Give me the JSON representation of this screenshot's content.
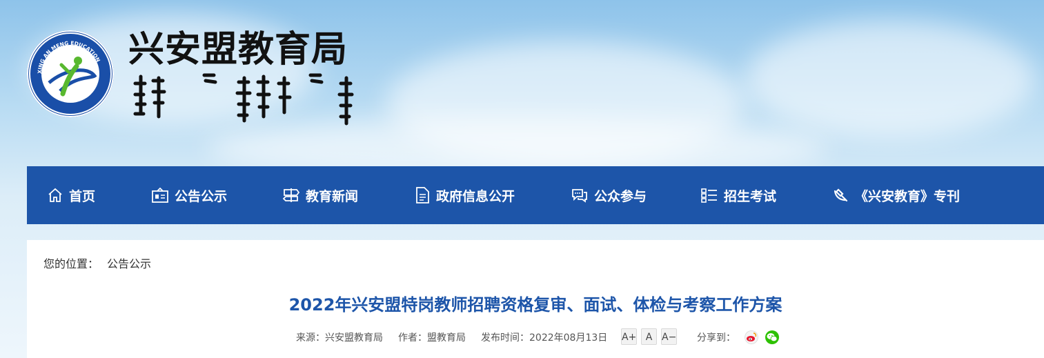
{
  "site": {
    "title": "兴安盟教育局",
    "emblem_text": "XING AN MENG EDUCATION"
  },
  "nav": {
    "items": [
      {
        "label": "首页",
        "icon": "home-icon"
      },
      {
        "label": "公告公示",
        "icon": "notice-board-icon"
      },
      {
        "label": "教育新闻",
        "icon": "signpost-icon"
      },
      {
        "label": "政府信息公开",
        "icon": "document-icon"
      },
      {
        "label": "公众参与",
        "icon": "chat-bubbles-icon"
      },
      {
        "label": "招生考试",
        "icon": "list-icon"
      },
      {
        "label": "《兴安教育》专刊",
        "icon": "party-emblem-icon"
      }
    ]
  },
  "breadcrumb": {
    "prefix": "您的位置：",
    "current": "公告公示"
  },
  "article": {
    "title": "2022年兴安盟特岗教师招聘资格复审、面试、体检与考察工作方案",
    "source": "来源：兴安盟教育局",
    "author": "作者：盟教育局",
    "date": "发布时间：2022年08月13日",
    "font_increase": "A+",
    "font_normal": "A",
    "font_decrease": "A−",
    "share_label": "分享到："
  },
  "colors": {
    "nav_bg": "#1d55a9",
    "title_color": "#1d55a9",
    "weibo": "#e6162d",
    "wechat": "#2dc100"
  }
}
